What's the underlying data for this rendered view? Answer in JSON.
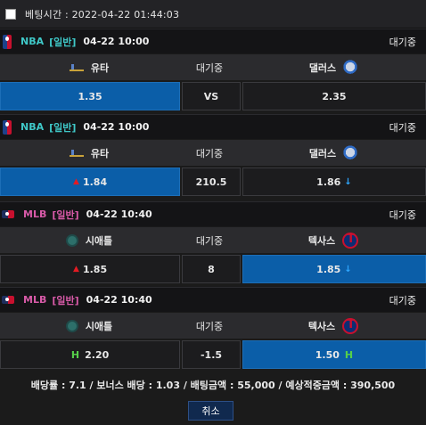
{
  "header": {
    "time_label": "베팅시간 : 2022-04-22 01:44:03"
  },
  "games": [
    {
      "league": "NBA",
      "type": "[일반]",
      "date": "04-22 10:00",
      "status": "대기중",
      "home": "유타",
      "mid_label": "대기중",
      "away": "댈러스",
      "home_icon": "jazz-logo-icon",
      "away_icon": "mavericks-logo-icon",
      "odds_home": "1.35",
      "odds_mid": "VS",
      "odds_away": "2.35",
      "selected": "home"
    },
    {
      "league": "NBA",
      "type": "[일반]",
      "date": "04-22 10:00",
      "status": "대기중",
      "home": "유타",
      "mid_label": "대기중",
      "away": "댈러스",
      "home_icon": "jazz-logo-icon",
      "away_icon": "mavericks-logo-icon",
      "odds_home": "1.84",
      "odds_mid": "210.5",
      "odds_away": "1.86",
      "home_arrow": "▲",
      "away_arrow": "↓",
      "selected": "home"
    },
    {
      "league": "MLB",
      "type": "[일반]",
      "date": "04-22 10:40",
      "status": "대기중",
      "home": "시애틀",
      "mid_label": "대기중",
      "away": "텍사스",
      "home_icon": "mariners-logo-icon",
      "away_icon": "rangers-logo-icon",
      "odds_home": "1.85",
      "odds_mid": "8",
      "odds_away": "1.85",
      "home_arrow": "▲",
      "away_arrow": "↓",
      "selected": "away"
    },
    {
      "league": "MLB",
      "type": "[일반]",
      "date": "04-22 10:40",
      "status": "대기중",
      "home": "시애틀",
      "mid_label": "대기중",
      "away": "텍사스",
      "home_icon": "mariners-logo-icon",
      "away_icon": "rangers-logo-icon",
      "odds_home": "2.20",
      "odds_mid": "-1.5",
      "odds_away": "1.50",
      "home_mark": "H",
      "away_mark": "H",
      "selected": "away"
    }
  ],
  "summary": "배당률 : 7.1 / 보너스 배당 : 1.03 / 배팅금액 : 55,000 / 예상적중금액 : 390,500",
  "cancel_label": "취소",
  "colors": {
    "selected_blue": "#0b5ea8",
    "nba": "#3fc8c8",
    "mlb": "#d85aa8",
    "up_red": "#e31b23",
    "down_blue": "#2ea7ff",
    "handicap_green": "#56d04a"
  }
}
